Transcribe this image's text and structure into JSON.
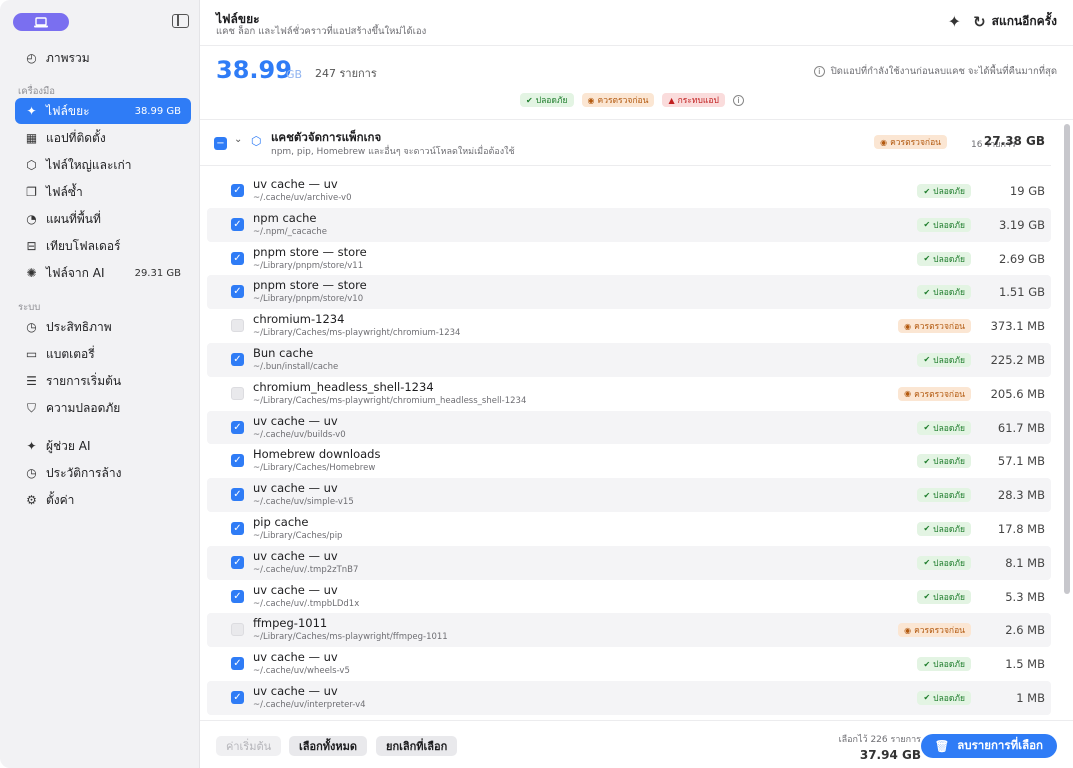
{
  "sidebar": {
    "section_tools": "เครื่องมือ",
    "section_system": "ระบบ",
    "items": [
      {
        "label": "ภาพรวม",
        "icon": "gauge-icon",
        "glyph": "◴",
        "badge": ""
      },
      {
        "label": "ไฟล์ขยะ",
        "icon": "sparkle-icon",
        "glyph": "✦",
        "badge": "38.99 GB"
      },
      {
        "label": "แอปที่ติดตั้ง",
        "icon": "grid-icon",
        "glyph": "▦",
        "badge": ""
      },
      {
        "label": "ไฟล์ใหญ่และเก่า",
        "icon": "box-icon",
        "glyph": "⬡",
        "badge": ""
      },
      {
        "label": "ไฟล์ซ้ำ",
        "icon": "copy-icon",
        "glyph": "❐",
        "badge": ""
      },
      {
        "label": "แผนที่พื้นที่",
        "icon": "pie-icon",
        "glyph": "◔",
        "badge": ""
      },
      {
        "label": "เทียบโฟลเดอร์",
        "icon": "compare-icon",
        "glyph": "⊟",
        "badge": ""
      },
      {
        "label": "ไฟล์จาก AI",
        "icon": "brain-icon",
        "glyph": "✺",
        "badge": "29.31 GB"
      },
      {
        "label": "ประสิทธิภาพ",
        "icon": "speed-icon",
        "glyph": "◷",
        "badge": ""
      },
      {
        "label": "แบตเตอรี่",
        "icon": "battery-icon",
        "glyph": "▭",
        "badge": ""
      },
      {
        "label": "รายการเริ่มต้น",
        "icon": "list-icon",
        "glyph": "☰",
        "badge": ""
      },
      {
        "label": "ความปลอดภัย",
        "icon": "shield-icon",
        "glyph": "⛉",
        "badge": ""
      },
      {
        "label": "ผู้ช่วย AI",
        "icon": "sparkle-icon",
        "glyph": "✦",
        "badge": ""
      },
      {
        "label": "ประวัติการล้าง",
        "icon": "history-icon",
        "glyph": "◷",
        "badge": ""
      },
      {
        "label": "ตั้งค่า",
        "icon": "gear-icon",
        "glyph": "⚙",
        "badge": ""
      }
    ]
  },
  "header": {
    "title": "ไฟล์ขยะ",
    "subtitle": "แคช ล็อก และไฟล์ชั่วคราวที่แอปสร้างขึ้นใหม่ได้เอง",
    "rescan_label": "สแกนอีกครั้ง"
  },
  "summary": {
    "size_value": "38.99",
    "size_unit": "GB",
    "item_count": "247 รายการ",
    "hint": "ปิดแอปที่กำลังใช้งานก่อนลบแคช จะได้พื้นที่คืนมากที่สุด",
    "filter_safe": "ปลอดภัย",
    "filter_review": "ควรตรวจก่อน",
    "filter_danger": "กระทบแอป"
  },
  "group": {
    "title": "แคชตัวจัดการแพ็กเกจ",
    "subtitle": "npm, pip, Homebrew และอื่นๆ จะดาวน์โหลดใหม่เมื่อต้องใช้",
    "chip": "ควรตรวจก่อน",
    "count": "16 รายการ",
    "size": "27.38 GB"
  },
  "labels": {
    "safe": "ปลอดภัย",
    "review": "ควรตรวจก่อน"
  },
  "rows": [
    {
      "name": "uv cache — uv",
      "path": "~/.cache/uv/archive-v0",
      "status": "safe",
      "checked": true,
      "size": "19 GB"
    },
    {
      "name": "npm cache",
      "path": "~/.npm/_cacache",
      "status": "safe",
      "checked": true,
      "size": "3.19 GB"
    },
    {
      "name": "pnpm store — store",
      "path": "~/Library/pnpm/store/v11",
      "status": "safe",
      "checked": true,
      "size": "2.69 GB"
    },
    {
      "name": "pnpm store — store",
      "path": "~/Library/pnpm/store/v10",
      "status": "safe",
      "checked": true,
      "size": "1.51 GB"
    },
    {
      "name": "chromium-1234",
      "path": "~/Library/Caches/ms-playwright/chromium-1234",
      "status": "review",
      "checked": false,
      "size": "373.1 MB"
    },
    {
      "name": "Bun cache",
      "path": "~/.bun/install/cache",
      "status": "safe",
      "checked": true,
      "size": "225.2 MB"
    },
    {
      "name": "chromium_headless_shell-1234",
      "path": "~/Library/Caches/ms-playwright/chromium_headless_shell-1234",
      "status": "review",
      "checked": false,
      "size": "205.6 MB"
    },
    {
      "name": "uv cache — uv",
      "path": "~/.cache/uv/builds-v0",
      "status": "safe",
      "checked": true,
      "size": "61.7 MB"
    },
    {
      "name": "Homebrew downloads",
      "path": "~/Library/Caches/Homebrew",
      "status": "safe",
      "checked": true,
      "size": "57.1 MB"
    },
    {
      "name": "uv cache — uv",
      "path": "~/.cache/uv/simple-v15",
      "status": "safe",
      "checked": true,
      "size": "28.3 MB"
    },
    {
      "name": "pip cache",
      "path": "~/Library/Caches/pip",
      "status": "safe",
      "checked": true,
      "size": "17.8 MB"
    },
    {
      "name": "uv cache — uv",
      "path": "~/.cache/uv/.tmp2zTnB7",
      "status": "safe",
      "checked": true,
      "size": "8.1 MB"
    },
    {
      "name": "uv cache — uv",
      "path": "~/.cache/uv/.tmpbLDd1x",
      "status": "safe",
      "checked": true,
      "size": "5.3 MB"
    },
    {
      "name": "ffmpeg-1011",
      "path": "~/Library/Caches/ms-playwright/ffmpeg-1011",
      "status": "review",
      "checked": false,
      "size": "2.6 MB"
    },
    {
      "name": "uv cache — uv",
      "path": "~/.cache/uv/wheels-v5",
      "status": "safe",
      "checked": true,
      "size": "1.5 MB"
    },
    {
      "name": "uv cache — uv",
      "path": "~/.cache/uv/interpreter-v4",
      "status": "safe",
      "checked": true,
      "size": "1 MB"
    }
  ],
  "footer": {
    "defaults_label": "ค่าเริ่มต้น",
    "select_all_label": "เลือกทั้งหมด",
    "deselect_label": "ยกเลิกที่เลือก",
    "selected_label": "เลือกไว้ 226 รายการ",
    "selected_size": "37.94 GB",
    "delete_label": "ลบรายการที่เลือก"
  }
}
